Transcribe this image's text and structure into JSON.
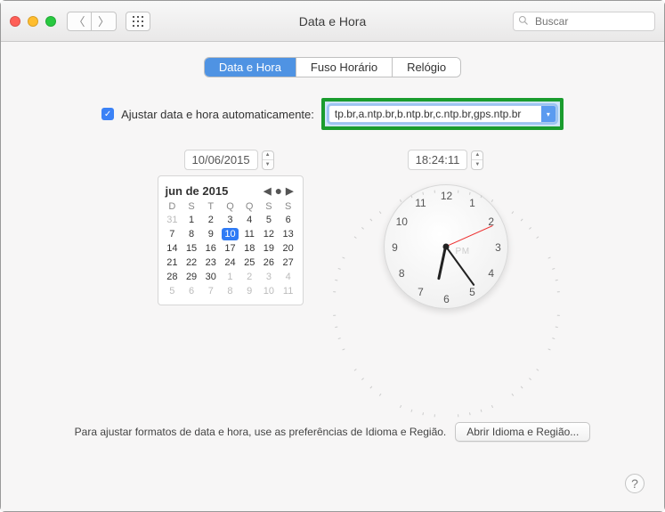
{
  "window": {
    "title": "Data e Hora"
  },
  "search": {
    "placeholder": "Buscar"
  },
  "tabs": {
    "data_e_hora": "Data e Hora",
    "fuso": "Fuso Horário",
    "relogio": "Relógio",
    "active": 0
  },
  "auto": {
    "checked": true,
    "label": "Ajustar data e hora automaticamente:",
    "server": "tp.br,a.ntp.br,b.ntp.br,c.ntp.br,gps.ntp.br"
  },
  "date": {
    "value": "10/06/2015",
    "month_label": "jun de 2015",
    "weekdays": [
      "D",
      "S",
      "T",
      "Q",
      "Q",
      "S",
      "S"
    ],
    "leading_gray": [
      31
    ],
    "days": [
      1,
      2,
      3,
      4,
      5,
      6,
      7,
      8,
      9,
      10,
      11,
      12,
      13,
      14,
      15,
      16,
      17,
      18,
      19,
      20,
      21,
      22,
      23,
      24,
      25,
      26,
      27,
      28,
      29,
      30
    ],
    "trailing_gray": [
      1,
      2,
      3,
      4,
      5,
      6,
      7,
      8,
      9,
      10,
      11
    ],
    "selected_day": 10
  },
  "time": {
    "value": "18:24:11",
    "ampm": "PM",
    "hour_angle": 192,
    "minute_angle": 144,
    "second_angle": 66
  },
  "clock_numbers": [
    "12",
    "1",
    "2",
    "3",
    "4",
    "5",
    "6",
    "7",
    "8",
    "9",
    "10",
    "11"
  ],
  "footer": {
    "hint": "Para ajustar formatos de data e hora, use as preferências de Idioma e Região.",
    "open_label": "Abrir Idioma e Região..."
  },
  "help": "?"
}
